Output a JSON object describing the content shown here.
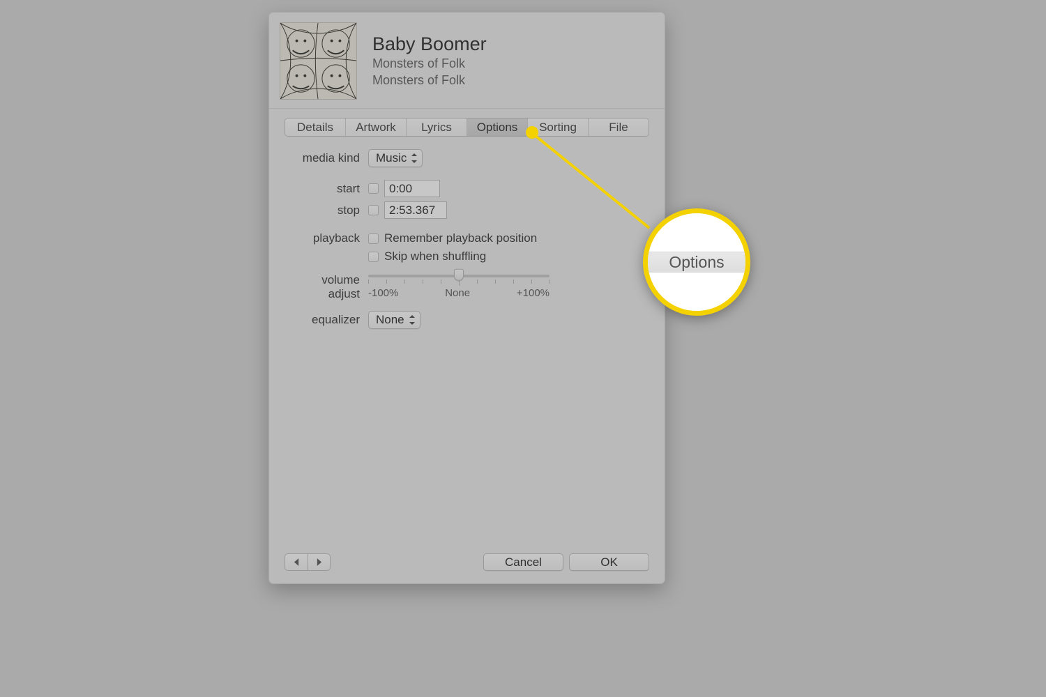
{
  "header": {
    "title": "Baby Boomer",
    "artist": "Monsters of Folk",
    "album": "Monsters of Folk"
  },
  "tabs": {
    "items": [
      "Details",
      "Artwork",
      "Lyrics",
      "Options",
      "Sorting",
      "File"
    ],
    "active": "Options"
  },
  "form": {
    "media_kind_label": "media kind",
    "media_kind_value": "Music",
    "start_label": "start",
    "start_value": "0:00",
    "stop_label": "stop",
    "stop_value": "2:53.367",
    "playback_label": "playback",
    "playback_remember": "Remember playback position",
    "playback_skip": "Skip when shuffling",
    "volume_label": "volume adjust",
    "volume_min": "-100%",
    "volume_mid": "None",
    "volume_max": "+100%",
    "equalizer_label": "equalizer",
    "equalizer_value": "None"
  },
  "footer": {
    "cancel": "Cancel",
    "ok": "OK"
  },
  "callout": {
    "label": "Options"
  }
}
